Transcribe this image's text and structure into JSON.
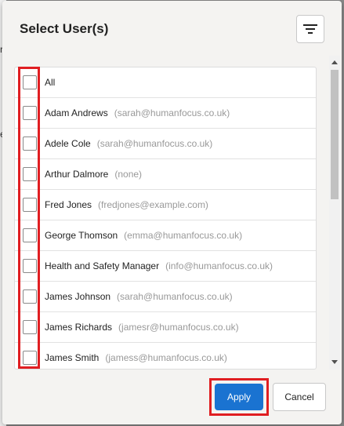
{
  "background": {
    "left_chars": [
      "r",
      "e"
    ]
  },
  "dialog": {
    "title": "Select User(s)",
    "filter_icon": "filter-lines-icon"
  },
  "users": [
    {
      "name": "All",
      "email": ""
    },
    {
      "name": "Adam Andrews",
      "email": "(sarah@humanfocus.co.uk)"
    },
    {
      "name": "Adele Cole",
      "email": "(sarah@humanfocus.co.uk)"
    },
    {
      "name": "Arthur Dalmore",
      "email": "(none)"
    },
    {
      "name": "Fred Jones",
      "email": "(fredjones@example.com)"
    },
    {
      "name": "George Thomson",
      "email": "(emma@humanfocus.co.uk)"
    },
    {
      "name": "Health and Safety Manager",
      "email": "(info@humanfocus.co.uk)"
    },
    {
      "name": "James Johnson",
      "email": "(sarah@humanfocus.co.uk)"
    },
    {
      "name": "James Richards",
      "email": "(jamesr@humanfocus.co.uk)"
    },
    {
      "name": "James Smith",
      "email": "(jamess@humanfocus.co.uk)"
    }
  ],
  "footer": {
    "apply_label": "Apply",
    "cancel_label": "Cancel"
  },
  "colors": {
    "accent": "#1a73d1",
    "highlight": "#e01e22"
  }
}
